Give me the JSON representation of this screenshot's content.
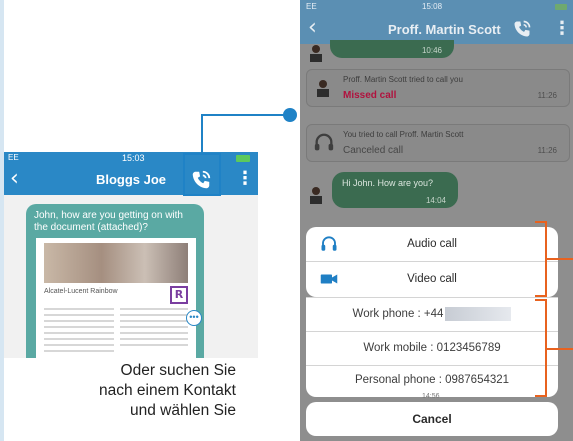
{
  "colors": {
    "ios_blue": "#2a88c6",
    "highlight_blue": "#1f82c6",
    "annotation_orange": "#e8621f",
    "missed_call_red": "#b0123e",
    "card_teal": "#5aa9a3"
  },
  "left_phone": {
    "status_carrier": "EE",
    "status_time": "15:03",
    "title": "Bloggs Joe",
    "back_icon": "chevron-left-icon",
    "call_icon": "phone-call-icon",
    "menu_icon": "kebab-menu-icon",
    "card_message": "John, how are you getting on with the document (attached)?",
    "doc_title": "Alcatel-Lucent Rainbow",
    "doc_logo": "R",
    "more_icon": "ellipsis-icon"
  },
  "caption": {
    "lines": [
      "Oder suchen Sie",
      "nach einem Kontakt",
      "und wählen Sie"
    ]
  },
  "right_phone": {
    "status_carrier": "EE",
    "status_time": "15:08",
    "title": "Proff. Martin Scott",
    "back_icon": "chevron-left-icon",
    "call_icon": "phone-call-icon",
    "menu_icon": "kebab-menu-icon",
    "top_bubble_time": "10:46",
    "events": [
      {
        "text": "Proff. Martin Scott tried to call you",
        "status": "Missed call",
        "time": "11:26"
      },
      {
        "text": "You tried to call Proff. Martin Scott",
        "status": "Canceled call",
        "time": "11:26"
      }
    ],
    "incoming_message": {
      "text": "Hi John. How are you?",
      "time": "14:04"
    },
    "action_sheet": {
      "audio_call": "Audio call",
      "video_call": "Video call",
      "work_phone": "Work phone : +44",
      "work_mobile": "Work mobile : 0123456789",
      "personal_phone": "Personal phone : 0987654321",
      "cancel": "Cancel",
      "under_sheet_time": "14:56"
    }
  }
}
